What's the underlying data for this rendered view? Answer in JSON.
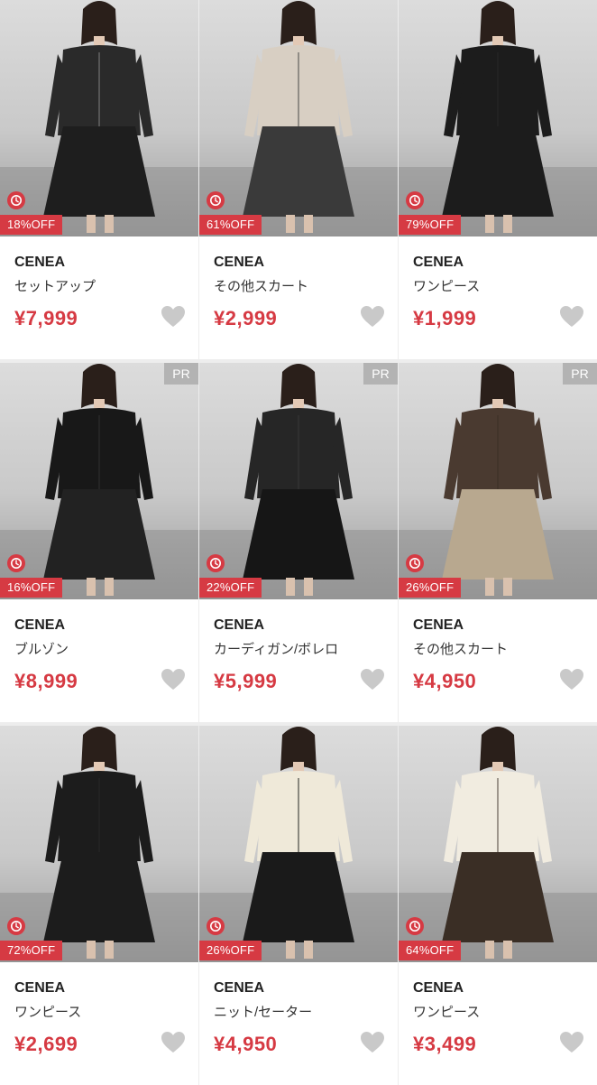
{
  "products": [
    {
      "pr": "",
      "discount": "18%OFF",
      "brand": "CENEA",
      "category": "セットアップ",
      "price": "¥7,999",
      "garment": "dark-setup",
      "icons": {
        "timer": "clock-icon",
        "favorite": "heart-icon"
      }
    },
    {
      "pr": "",
      "discount": "61%OFF",
      "brand": "CENEA",
      "category": "その他スカート",
      "price": "¥2,999",
      "garment": "dark-skirt",
      "icons": {
        "timer": "clock-icon",
        "favorite": "heart-icon"
      }
    },
    {
      "pr": "",
      "discount": "79%OFF",
      "brand": "CENEA",
      "category": "ワンピース",
      "price": "¥1,999",
      "garment": "black-dress",
      "icons": {
        "timer": "clock-icon",
        "favorite": "heart-icon"
      }
    },
    {
      "pr": "PR",
      "discount": "16%OFF",
      "brand": "CENEA",
      "category": "ブルゾン",
      "price": "¥8,999",
      "garment": "black-jacket",
      "icons": {
        "timer": "clock-icon",
        "favorite": "heart-icon"
      }
    },
    {
      "pr": "PR",
      "discount": "22%OFF",
      "brand": "CENEA",
      "category": "カーディガン/ボレロ",
      "price": "¥5,999",
      "garment": "black-cardigan",
      "icons": {
        "timer": "clock-icon",
        "favorite": "heart-icon"
      }
    },
    {
      "pr": "PR",
      "discount": "26%OFF",
      "brand": "CENEA",
      "category": "その他スカート",
      "price": "¥4,950",
      "garment": "beige-skirt",
      "icons": {
        "timer": "clock-icon",
        "favorite": "heart-icon"
      }
    },
    {
      "pr": "",
      "discount": "72%OFF",
      "brand": "CENEA",
      "category": "ワンピース",
      "price": "¥2,699",
      "garment": "black-dress",
      "icons": {
        "timer": "clock-icon",
        "favorite": "heart-icon"
      }
    },
    {
      "pr": "",
      "discount": "26%OFF",
      "brand": "CENEA",
      "category": "ニット/セーター",
      "price": "¥4,950",
      "garment": "cream-knit",
      "icons": {
        "timer": "clock-icon",
        "favorite": "heart-icon"
      }
    },
    {
      "pr": "",
      "discount": "64%OFF",
      "brand": "CENEA",
      "category": "ワンピース",
      "price": "¥3,499",
      "garment": "brown-dress",
      "icons": {
        "timer": "clock-icon",
        "favorite": "heart-icon"
      }
    }
  ],
  "colors": {
    "accent": "#d63a43",
    "pr_badge": "#b3b3b3",
    "heart": "#c9c9c9"
  }
}
